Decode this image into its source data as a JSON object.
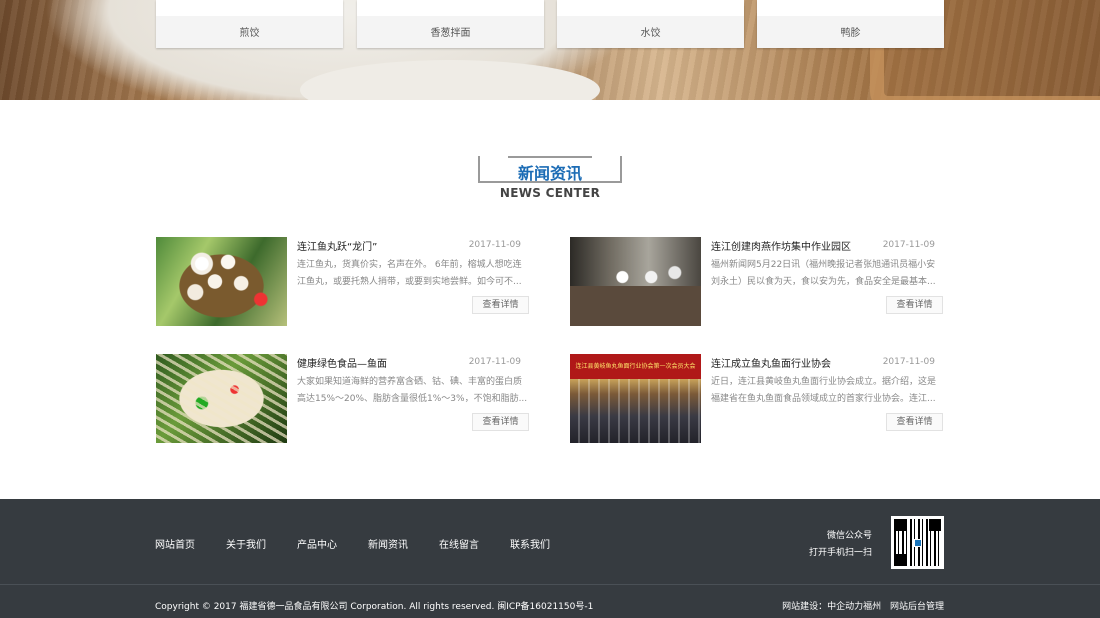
{
  "product_cards": [
    {
      "label": "煎饺"
    },
    {
      "label": "香葱拌面"
    },
    {
      "label": "水饺"
    },
    {
      "label": "鸭胗"
    }
  ],
  "news": {
    "title_cn": "新闻资讯",
    "title_en": "NEWS CENTER",
    "more_label": "查看详情",
    "items": [
      {
        "title": "连江鱼丸跃“龙门”",
        "date": "2017-11-09",
        "summary": "连江鱼丸，货真价实，名声在外。 6年前，榕城人想吃连江鱼丸，或要托熟人捎带，或要到实地尝鲜。如今可不..."
      },
      {
        "title": "连江创建肉燕作坊集中作业园区",
        "date": "2017-11-09",
        "summary": "福州新闻网5月22日讯（福州晚报记者张旭通讯员福小安刘永土）民以食为天，食以安为先，食品安全是最基本..."
      },
      {
        "title": "健康绿色食品—鱼面",
        "date": "2017-11-09",
        "summary": "大家如果知道海鲜的营养富含硒、钴、碘、丰富的蛋白质高达15%～20%、脂肪含量很低1%～3%，不饱和脂肪..."
      },
      {
        "title": "连江成立鱼丸鱼面行业协会",
        "date": "2017-11-09",
        "summary": "近日，连江县黄岐鱼丸鱼面行业协会成立。据介绍，这是福建省在鱼丸鱼面食品领域成立的首家行业协会。连江..."
      }
    ],
    "meeting_banner_text": "连江县黄岐鱼丸鱼面行业协会第一次会员大会"
  },
  "footer": {
    "nav": [
      "网站首页",
      "关于我们",
      "产品中心",
      "新闻资讯",
      "在线留言",
      "联系我们"
    ],
    "wechat_title": "微信公众号",
    "wechat_sub": "打开手机扫一扫",
    "copyright": "Copyright © 2017 福建省德一品食品有限公司 Corporation. All rights reserved.    闽ICP备16021150号-1",
    "credit_build": "网站建设：中企动力福州",
    "credit_admin": "网站后台管理"
  },
  "icons": {
    "qr": "qr-code-icon"
  }
}
